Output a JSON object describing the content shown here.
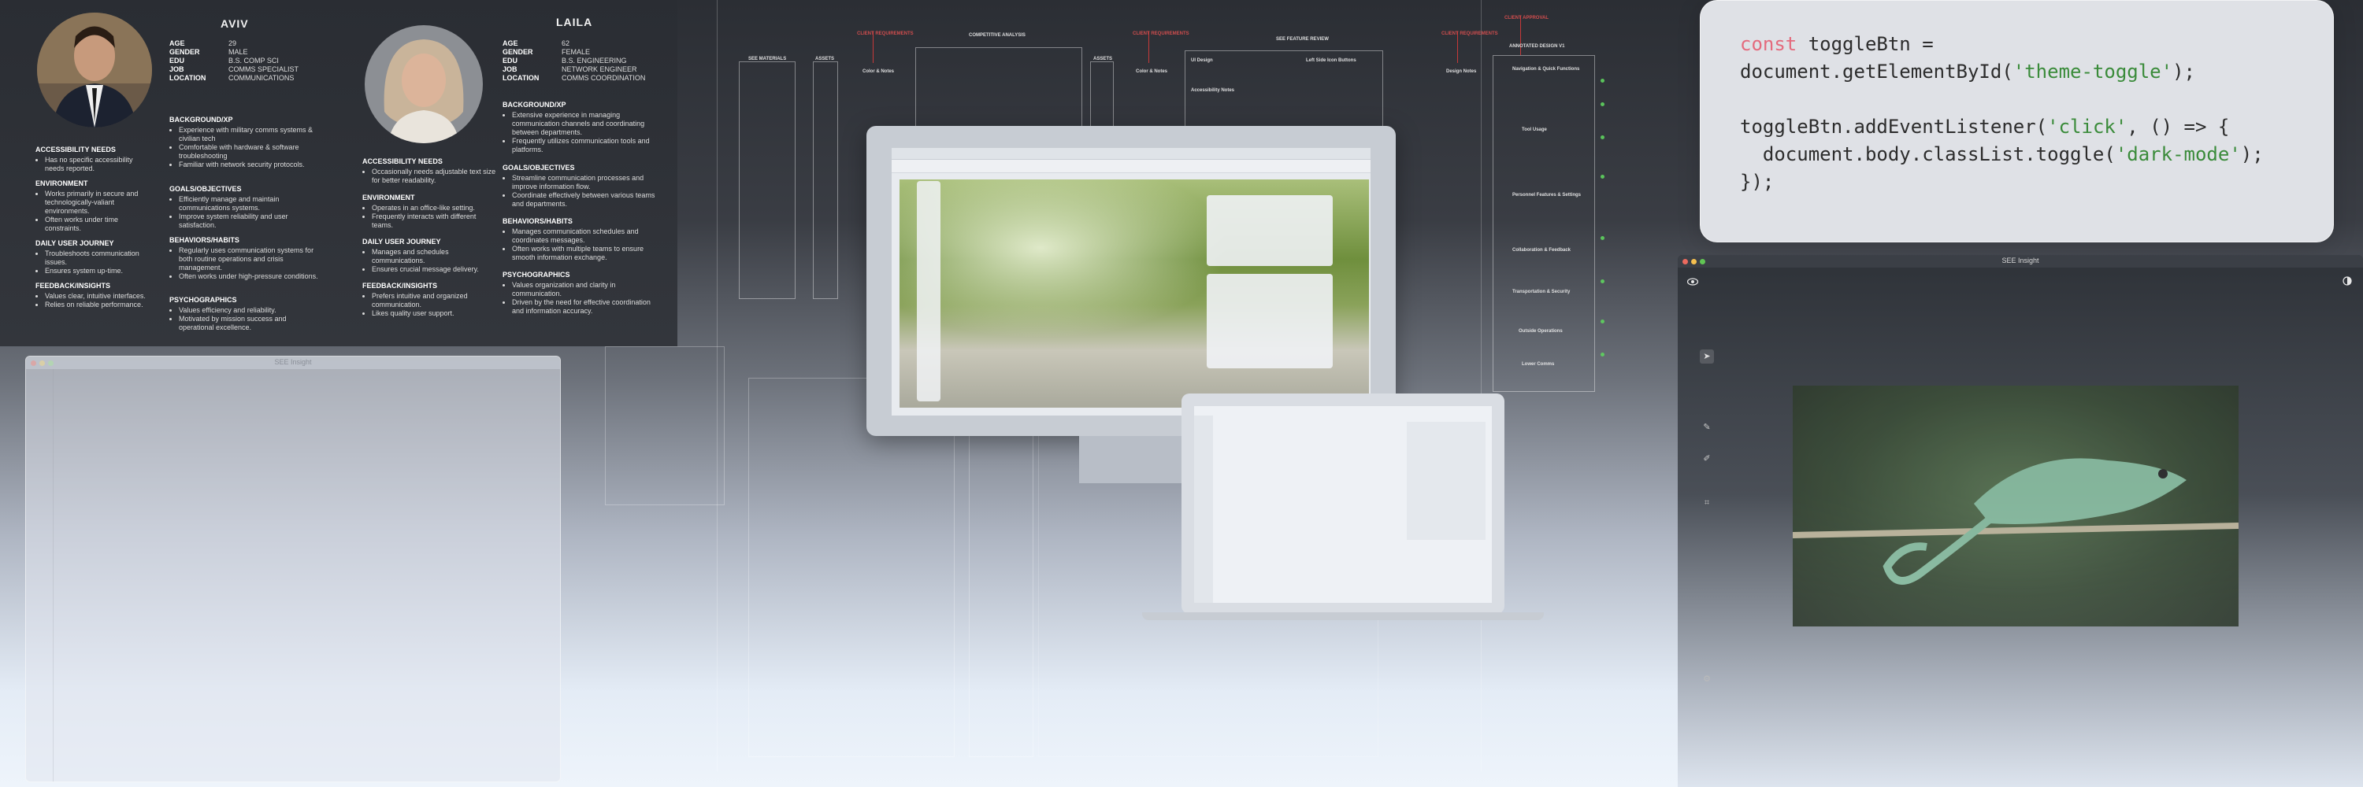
{
  "personas": [
    {
      "name": "AVIV",
      "age": "29",
      "gender": "MALE",
      "edu": "B.S. COMP SCI",
      "job": "COMMS SPECIALIST",
      "location": "COMMUNICATIONS",
      "accessibility_needs": [
        "Has no specific accessibility needs reported."
      ],
      "environment": [
        "Works primarily in secure and technologically-valiant environments.",
        "Often works under time constraints."
      ],
      "daily_user_journey": [
        "Troubleshoots communication issues.",
        "Ensures system up-time."
      ],
      "feedback_insights": [
        "Values clear, intuitive interfaces.",
        "Relies on reliable performance."
      ],
      "background_xp": [
        "Experience with military comms systems & civilian tech",
        "Comfortable with hardware & software troubleshooting",
        "Familiar with network security protocols."
      ],
      "goals_objectives": [
        "Efficiently manage and maintain communications systems.",
        "Improve system reliability and user satisfaction."
      ],
      "behaviors_habits": [
        "Regularly uses communication systems for both routine operations and crisis management.",
        "Often works under high-pressure conditions."
      ],
      "psychographics": [
        "Values efficiency and reliability.",
        "Motivated by mission success and operational excellence."
      ]
    },
    {
      "name": "LAILA",
      "age": "62",
      "gender": "FEMALE",
      "edu": "B.S. ENGINEERING",
      "job": "NETWORK ENGINEER",
      "location": "COMMS COORDINATION",
      "accessibility_needs": [
        "Occasionally needs adjustable text size for better readability."
      ],
      "environment": [
        "Operates in an office-like setting.",
        "Frequently interacts with different teams."
      ],
      "daily_user_journey": [
        "Manages and schedules communications.",
        "Ensures crucial message delivery."
      ],
      "feedback_insights": [
        "Prefers intuitive and organized communication.",
        "Likes quality user support."
      ],
      "background_xp": [
        "Extensive experience in managing communication channels and coordinating between departments.",
        "Frequently utilizes communication tools and platforms."
      ],
      "goals_objectives": [
        "Streamline communication processes and improve information flow.",
        "Coordinate effectively between various teams and departments."
      ],
      "behaviors_habits": [
        "Manages communication schedules and coordinates messages.",
        "Often works with multiple teams to ensure smooth information exchange."
      ],
      "psychographics": [
        "Values organization and clarity in communication.",
        "Driven by the need for effective coordination and information accuracy."
      ]
    }
  ],
  "labels": {
    "age": "AGE",
    "gender": "GENDER",
    "edu": "EDU",
    "job": "JOB",
    "location": "LOCATION",
    "accessibility_needs": "ACCESSIBILITY NEEDS",
    "environment": "ENVIRONMENT",
    "daily_user_journey": "DAILY USER JOURNEY",
    "feedback_insights": "FEEDBACK/INSIGHTS",
    "background_xp": "BACKGROUND/XP",
    "goals_objectives": "GOALS/OBJECTIVES",
    "behaviors_habits": "BEHAVIORS/HABITS",
    "psychographics": "PSYCHOGRAPHICS"
  },
  "board": {
    "headers": [
      "SEE MATERIALS",
      "ASSETS",
      "COMPETITIVE ANALYSIS",
      "ASSETS",
      "SEE FEATURE REVIEW",
      "ANNOTATED DESIGN V1"
    ],
    "red_labels": [
      "CLIENT REQUIREMENTS",
      "CLIENT REQUIREMENTS",
      "CLIENT REQUIREMENTS",
      "CLIENT APPROVAL"
    ],
    "sub_headers": [
      "Color & Notes",
      "Color & Notes",
      "Design Notes",
      "Navigation & Quick Functions",
      "Tool Usage",
      "Personnel Features & Settings",
      "Collaboration & Feedback",
      "Transportation & Security",
      "Outside Operations",
      "Lower Comms"
    ],
    "feature_review_items": [
      "UI Design",
      "Left Side Icon Buttons",
      "Accessibility Notes"
    ]
  },
  "code": {
    "line1_kw": "const",
    "line1_rest": " toggleBtn =",
    "line2_pre": "document.getElementById(",
    "line2_str": "'theme-toggle'",
    "line2_post": ");",
    "line4_pre": "toggleBtn.addEventListener(",
    "line4_str": "'click'",
    "line4_post": ", () => {",
    "line5_pre": "  document.body.classList.toggle(",
    "line5_str": "'dark-mode'",
    "line5_post": ");",
    "line6": "});"
  },
  "right_window": {
    "title": "SEE Insight"
  },
  "left_window": {
    "title": "SEE Insight"
  },
  "colors": {
    "accent_red": "#d83a3a",
    "code_keyword": "#e46a7d",
    "code_string": "#3a8b3a",
    "dot_green": "#5fd35f"
  },
  "icons": [
    "eye-icon",
    "contrast-icon",
    "cursor-icon",
    "brush-icon",
    "pen-icon",
    "crop-icon",
    "settings-icon"
  ]
}
